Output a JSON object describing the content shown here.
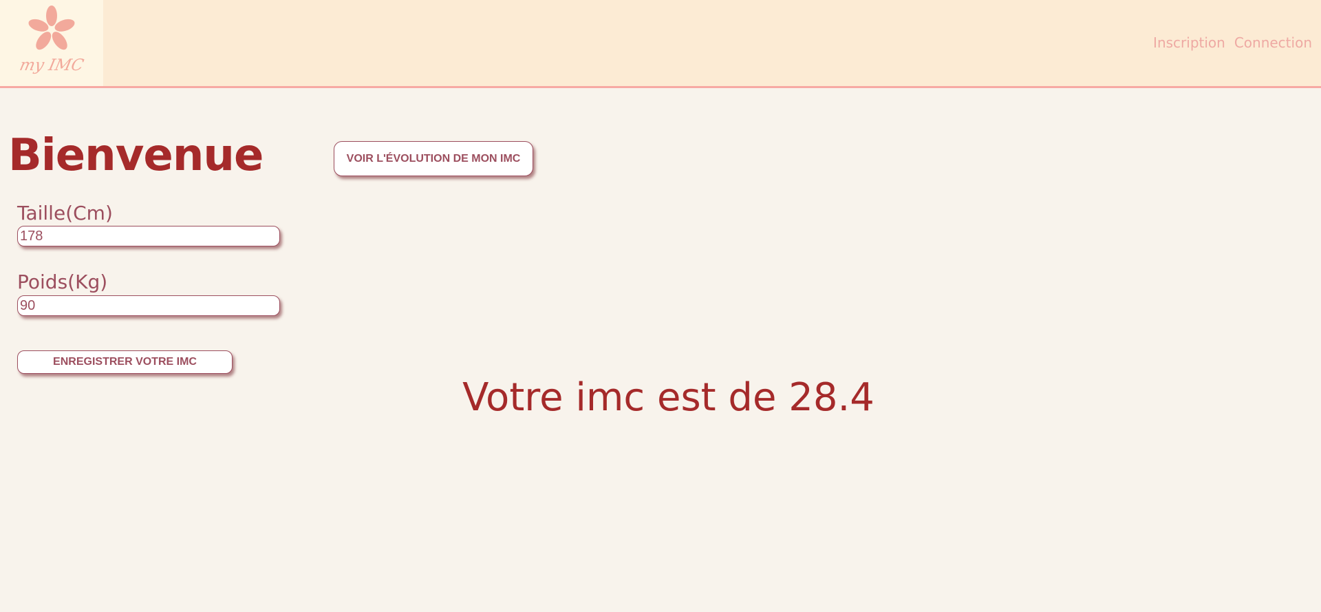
{
  "header": {
    "logo_text": "my IMC",
    "nav": {
      "inscription": "Inscription",
      "connection": "Connection"
    }
  },
  "main": {
    "title": "Bienvenue",
    "evolution_button": "VOIR L'ÉVOLUTION DE MON IMC",
    "height_label": "Taille(Cm)",
    "height_value": "178",
    "weight_label": "Poids(Kg)",
    "weight_value": "90",
    "save_button": "ENREGISTRER VOTRE IMC",
    "result": "Votre imc est de 28.4"
  },
  "colors": {
    "header_bg": "#fcebd4",
    "logo_bg": "#fef6e4",
    "header_border": "#f7a9a3",
    "page_bg": "#f8f3ec",
    "title": "#a52a2a",
    "accent": "#9c4e5e",
    "nav": "#eea9a3",
    "logo": "#f2a99b"
  },
  "icons": {
    "logo": "flower-icon"
  }
}
